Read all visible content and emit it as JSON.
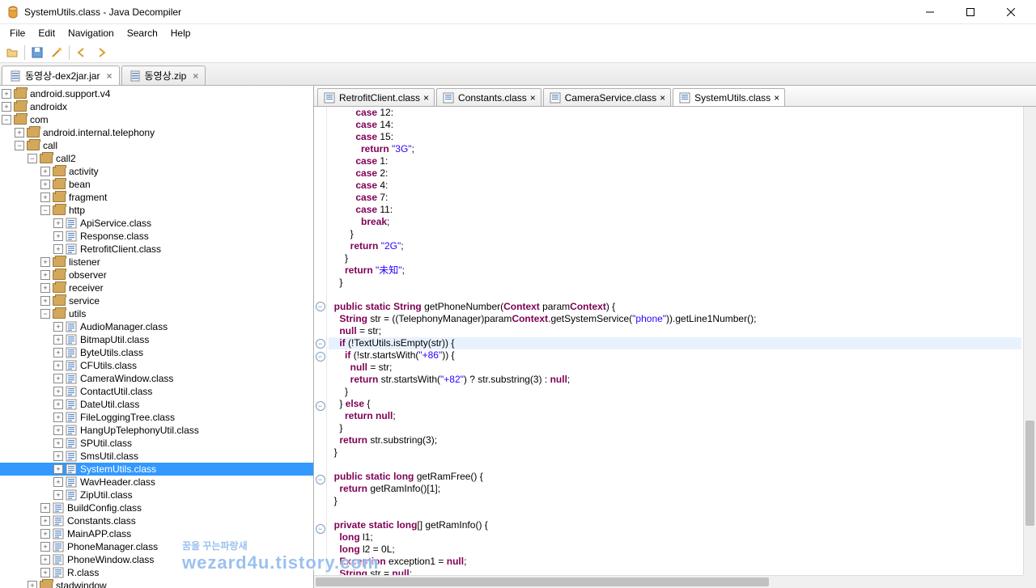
{
  "window": {
    "title": "SystemUtils.class - Java Decompiler"
  },
  "menu": {
    "file": "File",
    "edit": "Edit",
    "navigation": "Navigation",
    "search": "Search",
    "help": "Help"
  },
  "topTabs": [
    {
      "label": "동영상-dex2jar.jar",
      "closable": true
    },
    {
      "label": "동영상.zip",
      "closable": true
    }
  ],
  "tree": [
    {
      "d": 0,
      "t": "pkg",
      "exp": "+",
      "label": "android.support.v4"
    },
    {
      "d": 0,
      "t": "pkg",
      "exp": "+",
      "label": "androidx"
    },
    {
      "d": 0,
      "t": "pkg",
      "exp": "-",
      "label": "com"
    },
    {
      "d": 1,
      "t": "pkg",
      "exp": "+",
      "label": "android.internal.telephony"
    },
    {
      "d": 1,
      "t": "pkg",
      "exp": "-",
      "label": "call"
    },
    {
      "d": 2,
      "t": "pkg",
      "exp": "-",
      "label": "call2"
    },
    {
      "d": 3,
      "t": "pkg",
      "exp": "+",
      "label": "activity"
    },
    {
      "d": 3,
      "t": "pkg",
      "exp": "+",
      "label": "bean"
    },
    {
      "d": 3,
      "t": "pkg",
      "exp": "+",
      "label": "fragment"
    },
    {
      "d": 3,
      "t": "pkg",
      "exp": "-",
      "label": "http"
    },
    {
      "d": 4,
      "t": "cls",
      "exp": "+",
      "label": "ApiService.class"
    },
    {
      "d": 4,
      "t": "cls",
      "exp": "+",
      "label": "Response.class"
    },
    {
      "d": 4,
      "t": "cls",
      "exp": "+",
      "label": "RetrofitClient.class"
    },
    {
      "d": 3,
      "t": "pkg",
      "exp": "+",
      "label": "listener"
    },
    {
      "d": 3,
      "t": "pkg",
      "exp": "+",
      "label": "observer"
    },
    {
      "d": 3,
      "t": "pkg",
      "exp": "+",
      "label": "receiver"
    },
    {
      "d": 3,
      "t": "pkg",
      "exp": "+",
      "label": "service"
    },
    {
      "d": 3,
      "t": "pkg",
      "exp": "-",
      "label": "utils"
    },
    {
      "d": 4,
      "t": "cls",
      "exp": "+",
      "label": "AudioManager.class"
    },
    {
      "d": 4,
      "t": "cls",
      "exp": "+",
      "label": "BitmapUtil.class"
    },
    {
      "d": 4,
      "t": "cls",
      "exp": "+",
      "label": "ByteUtils.class"
    },
    {
      "d": 4,
      "t": "cls",
      "exp": "+",
      "label": "CFUtils.class"
    },
    {
      "d": 4,
      "t": "cls",
      "exp": "+",
      "label": "CameraWindow.class"
    },
    {
      "d": 4,
      "t": "cls",
      "exp": "+",
      "label": "ContactUtil.class"
    },
    {
      "d": 4,
      "t": "cls",
      "exp": "+",
      "label": "DateUtil.class"
    },
    {
      "d": 4,
      "t": "cls",
      "exp": "+",
      "label": "FileLoggingTree.class"
    },
    {
      "d": 4,
      "t": "cls",
      "exp": "+",
      "label": "HangUpTelephonyUtil.class"
    },
    {
      "d": 4,
      "t": "cls",
      "exp": "+",
      "label": "SPUtil.class"
    },
    {
      "d": 4,
      "t": "cls",
      "exp": "+",
      "label": "SmsUtil.class"
    },
    {
      "d": 4,
      "t": "cls",
      "exp": "+",
      "label": "SystemUtils.class",
      "sel": true
    },
    {
      "d": 4,
      "t": "cls",
      "exp": "+",
      "label": "WavHeader.class"
    },
    {
      "d": 4,
      "t": "cls",
      "exp": "+",
      "label": "ZipUtil.class"
    },
    {
      "d": 3,
      "t": "cls",
      "exp": "+",
      "label": "BuildConfig.class"
    },
    {
      "d": 3,
      "t": "cls",
      "exp": "+",
      "label": "Constants.class"
    },
    {
      "d": 3,
      "t": "cls",
      "exp": "+",
      "label": "MainAPP.class"
    },
    {
      "d": 3,
      "t": "cls",
      "exp": "+",
      "label": "PhoneManager.class"
    },
    {
      "d": 3,
      "t": "cls",
      "exp": "+",
      "label": "PhoneWindow.class"
    },
    {
      "d": 3,
      "t": "cls",
      "exp": "+",
      "label": "R.class"
    },
    {
      "d": 2,
      "t": "pkg",
      "exp": "+",
      "label": "stadwindow"
    }
  ],
  "editorTabs": [
    {
      "label": "RetrofitClient.class"
    },
    {
      "label": "Constants.class"
    },
    {
      "label": "CameraService.class"
    },
    {
      "label": "SystemUtils.class",
      "active": true
    }
  ],
  "code": [
    "          case 12:",
    "          case 14:",
    "          case 15:",
    "            return \"3G\";",
    "          case 1:",
    "          case 2:",
    "          case 4:",
    "          case 7:",
    "          case 11:",
    "            break;",
    "        } ",
    "        return \"2G\";",
    "      } ",
    "      return \"未知\";",
    "    } ",
    "  ",
    "  public static String getPhoneNumber(Context paramContext) {",
    "    String str = ((TelephonyManager)paramContext.getSystemService(\"phone\")).getLine1Number();",
    "    null = str;",
    "    if (!TextUtils.isEmpty(str)) {",
    "      if (!str.startsWith(\"+86\")) {",
    "        null = str;",
    "        return str.startsWith(\"+82\") ? str.substring(3) : null;",
    "      } ",
    "    } else {",
    "      return null;",
    "    } ",
    "    return str.substring(3);",
    "  }",
    "  ",
    "  public static long getRamFree() {",
    "    return getRamInfo()[1];",
    "  }",
    "  ",
    "  private static long[] getRamInfo() {",
    "    long l1;",
    "    long l2 = 0L;",
    "    Exception exception1 = null;",
    "    String str = null;"
  ],
  "highlightLine": 19,
  "foldMarks": [
    16,
    19,
    20,
    24,
    30,
    34
  ],
  "watermark": {
    "line1": "꿈을 꾸는파랑새",
    "line2": "wezard4u.tistory.com"
  }
}
